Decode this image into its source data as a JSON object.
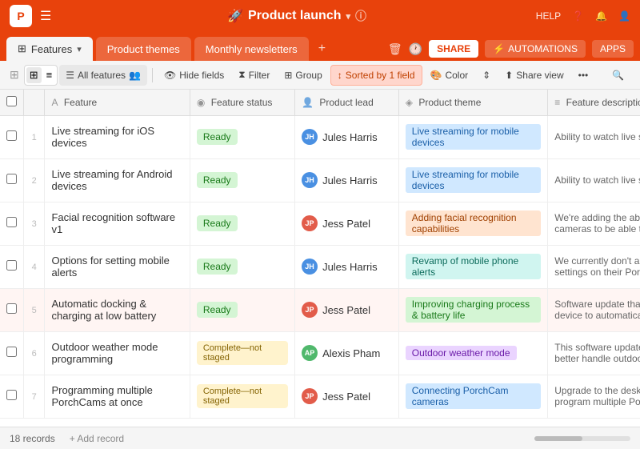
{
  "app": {
    "logo": "P",
    "project_name": "Product launch",
    "project_icon": "🚀",
    "project_caret": "▾",
    "help_label": "HELP",
    "share_label": "SHARE",
    "automations_label": "AUTOMATIONS",
    "apps_label": "APPS"
  },
  "tabs": [
    {
      "id": "features",
      "label": "Features",
      "active": true
    },
    {
      "id": "product-themes",
      "label": "Product themes",
      "active": false
    },
    {
      "id": "monthly-newsletters",
      "label": "Monthly newsletters",
      "active": false
    }
  ],
  "toolbar": {
    "all_features_label": "All features",
    "hide_fields_label": "Hide fields",
    "filter_label": "Filter",
    "group_label": "Group",
    "sorted_label": "Sorted by 1 field",
    "color_label": "Color",
    "share_view_label": "Share view"
  },
  "columns": [
    {
      "id": "feature",
      "label": "Feature",
      "icon": "A"
    },
    {
      "id": "status",
      "label": "Feature status",
      "icon": "◉"
    },
    {
      "id": "lead",
      "label": "Product lead",
      "icon": "👤"
    },
    {
      "id": "theme",
      "label": "Product theme",
      "icon": "◈"
    },
    {
      "id": "desc",
      "label": "Feature description",
      "icon": "≡"
    }
  ],
  "rows": [
    {
      "num": "1",
      "feature": "Live streaming for iOS devices",
      "status": "Ready",
      "status_type": "ready",
      "lead_name": "Jules Harris",
      "lead_avatar": "JH",
      "lead_type": "jh",
      "theme": "Live streaming for mobile devices",
      "theme_type": "blue",
      "desc": "Ability to watch live stream...",
      "highlight": false
    },
    {
      "num": "2",
      "feature": "Live streaming for Android devices",
      "status": "Ready",
      "status_type": "ready",
      "lead_name": "Jules Harris",
      "lead_avatar": "JH",
      "lead_type": "jh",
      "theme": "Live streaming for mobile devices",
      "theme_type": "blue",
      "desc": "Ability to watch live stream...",
      "highlight": false
    },
    {
      "num": "3",
      "feature": "Facial recognition software v1",
      "status": "Ready",
      "status_type": "ready",
      "lead_name": "Jess Patel",
      "lead_avatar": "JP",
      "lead_type": "jp",
      "theme": "Adding facial recognition capabilities",
      "theme_type": "orange",
      "desc": "We're adding the ability for cameras to be able to detect...",
      "highlight": false
    },
    {
      "num": "4",
      "feature": "Options for setting mobile alerts",
      "status": "Ready",
      "status_type": "ready",
      "lead_name": "Jules Harris",
      "lead_avatar": "JH",
      "lead_type": "jh",
      "theme": "Revamp of mobile phone alerts",
      "theme_type": "teal",
      "desc": "We currently don't allow users settings on their PorchCam...",
      "highlight": false
    },
    {
      "num": "5",
      "feature": "Automatic docking & charging at low battery",
      "status": "Ready",
      "status_type": "ready",
      "lead_name": "Jess Patel",
      "lead_avatar": "JP",
      "lead_type": "jp",
      "theme": "Improving charging process & battery life",
      "theme_type": "green",
      "desc": "Software update that allows device to automatically ret...",
      "highlight": true
    },
    {
      "num": "6",
      "feature": "Outdoor weather mode programming",
      "status": "Complete—not staged",
      "status_type": "complete-not",
      "lead_name": "Alexis Pham",
      "lead_avatar": "AP",
      "lead_type": "ap",
      "theme": "Outdoor weather mode",
      "theme_type": "purple",
      "desc": "This software update allows better handle outdoor weat...",
      "highlight": false
    },
    {
      "num": "7",
      "feature": "Programming multiple PorchCams at once",
      "status": "Complete—not staged",
      "status_type": "complete-not",
      "lead_name": "Jess Patel",
      "lead_avatar": "JP",
      "lead_type": "jp",
      "theme": "Connecting PorchCam cameras",
      "theme_type": "blue",
      "desc": "Upgrade to the desktop app program multiple PorchCam...",
      "highlight": false
    }
  ],
  "bottom": {
    "records_count": "18 records",
    "add_label": "+ Add record"
  }
}
